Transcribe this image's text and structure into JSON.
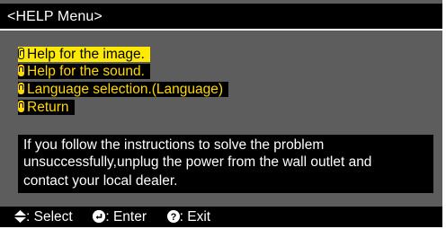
{
  "title": "<HELP Menu>",
  "menu": [
    {
      "label": "Help for the image.",
      "selected": true
    },
    {
      "label": "Help for the sound.",
      "selected": false
    },
    {
      "label": "Language selection.(Language)",
      "selected": false
    },
    {
      "label": "Return",
      "selected": false
    }
  ],
  "message": {
    "lines": [
      "If you follow the instructions to solve the problem",
      "unsuccessfully,unplug the power from the wall outlet and",
      "contact your local dealer."
    ]
  },
  "footer": {
    "select_label": ": Select",
    "enter_label": ": Enter",
    "exit_label": ": Exit",
    "select_icon": "up-down-arrow-icon",
    "enter_icon": "enter-icon",
    "exit_icon": "help-icon"
  },
  "colors": {
    "background": "#5d5d5d",
    "highlight": "#ffea00",
    "menu_text": "#ffd800",
    "panel": "#000000",
    "text": "#ffffff"
  }
}
